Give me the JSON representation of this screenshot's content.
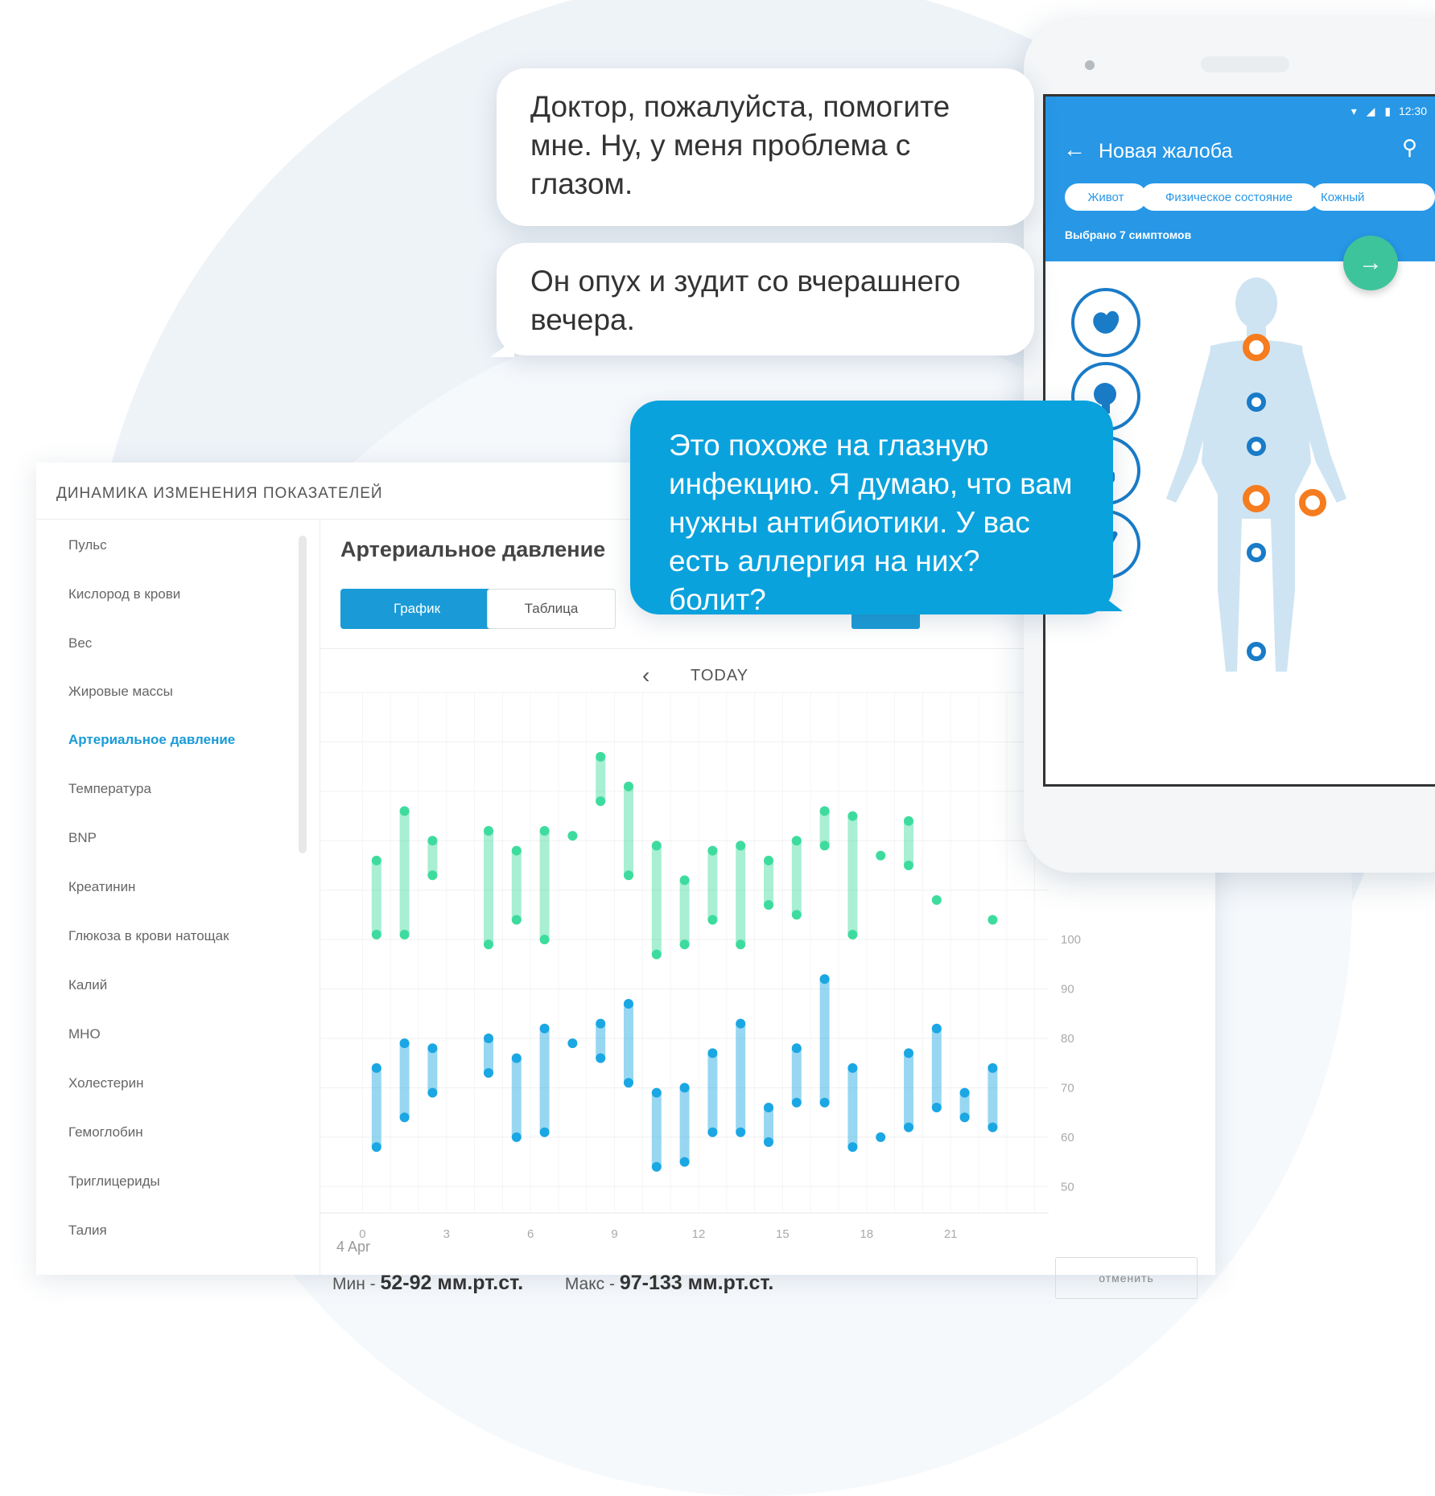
{
  "dashboard": {
    "title": "ДИНАМИКА ИЗМЕНЕНИЯ ПОКАЗАТЕЛЕЙ",
    "sidebar": {
      "items": [
        "Пульс",
        "Кислород в крови",
        "Вес",
        "Жировые массы",
        "Артериальное давление",
        "Температура",
        "BNP",
        "Креатинин",
        "Глюкоза в крови натощак",
        "Калий",
        "МНО",
        "Холестерин",
        "Гемоглобин",
        "Триглицериды",
        "Талия"
      ],
      "active_index": 4
    },
    "main": {
      "title": "Артериальное давление",
      "btn_graph": "График",
      "btn_table": "Таблица",
      "nav_today": "TODAY",
      "date_label": "4 Apr",
      "stats": {
        "min_label": "Мин - ",
        "min_value": "52-92 мм.рт.ст.",
        "max_label": "Макс - ",
        "max_value": "97-133 мм.рт.ст."
      },
      "cancel_button": "отменить"
    }
  },
  "chart_data": {
    "type": "range",
    "x_ticks": [
      "0",
      "3",
      "6",
      "9",
      "12",
      "15",
      "18",
      "21"
    ],
    "y_ticks": [
      "100",
      "90",
      "80",
      "70",
      "60",
      "50"
    ],
    "ylim": [
      45,
      150
    ],
    "xlim": [
      -0.5,
      24.5
    ],
    "colors": {
      "systolic": "#3ddc9e",
      "diastolic": "#1aa7e3"
    },
    "series": [
      {
        "key": "systolic",
        "ranges": [
          [
            0.5,
            101,
            116
          ],
          [
            1.5,
            101,
            126
          ],
          [
            2.5,
            113,
            120
          ],
          [
            4.5,
            99,
            122
          ],
          [
            5.5,
            104,
            118
          ],
          [
            6.5,
            100,
            122
          ],
          [
            7.5,
            121,
            121
          ],
          [
            8.5,
            128,
            137
          ],
          [
            9.5,
            113,
            131
          ],
          [
            10.5,
            97,
            119
          ],
          [
            11.5,
            99,
            112
          ],
          [
            12.5,
            104,
            118
          ],
          [
            13.5,
            99,
            119
          ],
          [
            14.5,
            107,
            116
          ],
          [
            15.5,
            105,
            120
          ],
          [
            16.5,
            119,
            126
          ],
          [
            17.5,
            101,
            125
          ],
          [
            18.5,
            117,
            117
          ],
          [
            19.5,
            115,
            124
          ],
          [
            20.5,
            108,
            108
          ],
          [
            22.5,
            104,
            104
          ]
        ]
      },
      {
        "key": "diastolic",
        "ranges": [
          [
            0.5,
            58,
            74
          ],
          [
            1.5,
            64,
            79
          ],
          [
            2.5,
            69,
            78
          ],
          [
            4.5,
            73,
            80
          ],
          [
            5.5,
            60,
            76
          ],
          [
            6.5,
            61,
            82
          ],
          [
            7.5,
            79,
            79
          ],
          [
            8.5,
            76,
            83
          ],
          [
            9.5,
            71,
            87
          ],
          [
            10.5,
            54,
            69
          ],
          [
            11.5,
            55,
            70
          ],
          [
            12.5,
            61,
            77
          ],
          [
            13.5,
            61,
            83
          ],
          [
            14.5,
            59,
            66
          ],
          [
            15.5,
            67,
            78
          ],
          [
            16.5,
            67,
            92
          ],
          [
            17.5,
            58,
            74
          ],
          [
            18.5,
            60,
            60
          ],
          [
            19.5,
            62,
            77
          ],
          [
            20.5,
            66,
            82
          ],
          [
            21.5,
            64,
            69
          ],
          [
            22.5,
            62,
            74
          ]
        ]
      }
    ]
  },
  "chat": {
    "bubble1": "Доктор, пожалуйста, помогите мне. Ну, у меня проблема с глазом.",
    "bubble2": "Он опух и зудит со вчерашнего вечера.",
    "bubble3": "Это похоже на глазную инфекцию. Я думаю, что вам нужны антибиотики. У вас есть аллергия на них? болит?"
  },
  "phone": {
    "status_time": "12:30",
    "title": "Новая жалоба",
    "chips": [
      "Живот",
      "Физическое состояние",
      "Кожный"
    ],
    "subtitle": "Выбрано 7 симптомов",
    "icons": [
      "back-arrow-icon",
      "search-icon",
      "forward-arrow-icon",
      "stomach-icon",
      "brain-icon",
      "skin-icon",
      "joint-icon"
    ],
    "body_markers": [
      {
        "color": "orange"
      },
      {
        "color": "blue"
      },
      {
        "color": "blue"
      },
      {
        "color": "orange"
      },
      {
        "color": "orange"
      },
      {
        "color": "blue"
      },
      {
        "color": "blue"
      }
    ]
  }
}
